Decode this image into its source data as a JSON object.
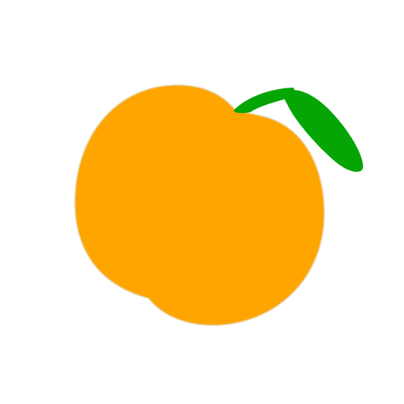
{
  "illustration": {
    "subject": "orange-fruit-icon",
    "colors": {
      "background": "#ffffff",
      "fruit": "#FFA500",
      "fruit_edge": "#E8D6B0",
      "leaf": "#06A506",
      "stem": "#06A506"
    }
  }
}
